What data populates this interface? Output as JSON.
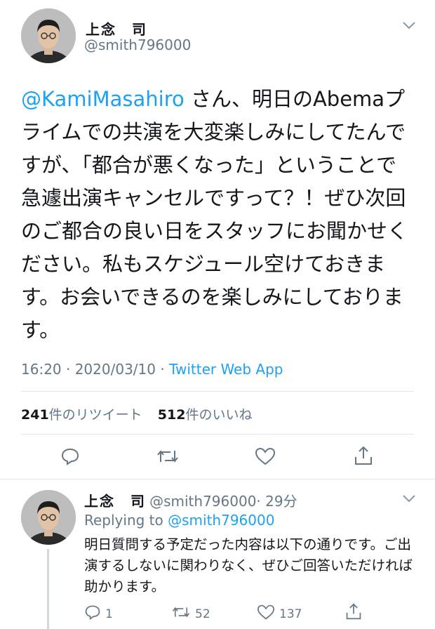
{
  "main_tweet": {
    "author_name": "上念　司",
    "author_handle": "@smith796000",
    "mention": "@KamiMasahiro",
    "text_after_mention": " さん、明日のAbemaプライムでの共演を大変楽しみにしてたんですが、「都合が悪くなった」ということで急遽出演キャンセルですって？！ぜひ次回のご都合の良い日をスタッフにお聞かせください。私もスケジュール空けておきます。お会いできるのを楽しみにしております。",
    "timestamp": "16:20 · 2020/03/10 · ",
    "source_app": "Twitter Web App",
    "retweet_count": "241",
    "retweet_label": "件のリツイート",
    "like_count": "512",
    "like_label": "件のいいね"
  },
  "reply_tweet": {
    "author_name": "上念　司",
    "author_handle": "@smith796000",
    "time_ago": "· 29分",
    "replying_prefix": "Replying to ",
    "replying_to": "@smith796000",
    "text": "明日質問する予定だった内容は以下の通りです。ご出演するしないに関わりなく、ぜひご回答いただければ助かります。",
    "reply_count": "1",
    "retweet_count": "52",
    "like_count": "137"
  },
  "icons": {
    "reply": "reply-icon",
    "retweet": "retweet-icon",
    "like": "heart-icon",
    "share": "share-icon",
    "more": "chevron-down-icon"
  },
  "colors": {
    "accent": "#1da1f2",
    "secondary_text": "#657786",
    "divider": "#e1e8ed"
  }
}
